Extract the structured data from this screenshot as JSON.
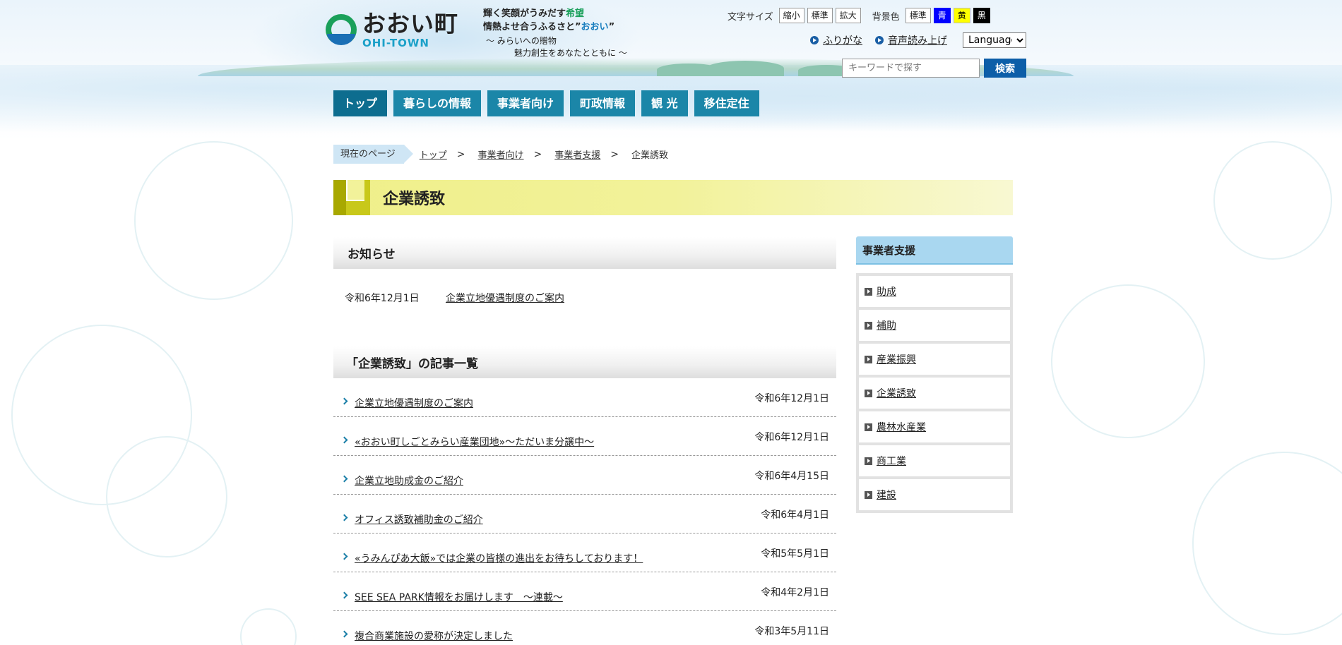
{
  "header": {
    "logo_jp": "おおい町",
    "logo_en": "OHI-TOWN",
    "tagline": {
      "line1_a": "輝く笑顔がうみだす",
      "line1_hl": "希望",
      "line2_a": "情熱よせ合うふるさと”",
      "line2_hl": "おおい",
      "line2_b": "”",
      "line3": "～ みらいへの贈物",
      "line4": "魅力創生をあなたとともに ～"
    },
    "font_size_label": "文字サイズ",
    "font_size_options": [
      "縮小",
      "標準",
      "拡大"
    ],
    "bg_color_label": "背景色",
    "bg_color_options": [
      "標準",
      "青",
      "黄",
      "黒"
    ],
    "furigana_link": "ふりがな",
    "speech_link": "音声読み上げ",
    "language_selected": "Language",
    "search": {
      "placeholder": "キーワードで探す",
      "button": "検索"
    }
  },
  "nav": {
    "items": [
      "トップ",
      "暮らしの情報",
      "事業者向け",
      "町政情報",
      "観 光",
      "移住定住"
    ],
    "active_index": 0
  },
  "breadcrumb": {
    "current_label": "現在のページ",
    "items": [
      "トップ",
      "事業者向け",
      "事業者支援"
    ],
    "current": "企業誘致",
    "separator": ">"
  },
  "page_title": "企業誘致",
  "notice": {
    "heading": "お知らせ",
    "date": "令和6年12月1日",
    "link": "企業立地優遇制度のご案内"
  },
  "article_list": {
    "heading": "「企業誘致」の記事一覧",
    "items": [
      {
        "title": "企業立地優遇制度のご案内",
        "date": "令和6年12月1日"
      },
      {
        "title": "«おおい町しごとみらい産業団地»～ただいま分譲中～",
        "date": "令和6年12月1日"
      },
      {
        "title": "企業立地助成金のご紹介",
        "date": "令和6年4月15日"
      },
      {
        "title": "オフィス誘致補助金のご紹介",
        "date": "令和6年4月1日"
      },
      {
        "title": "«うみんぴあ大飯»では企業の皆様の進出をお待ちしております！",
        "date": "令和5年5月1日"
      },
      {
        "title": "SEE SEA PARK情報をお届けします　～連載～",
        "date": "令和4年2月1日"
      },
      {
        "title": "複合商業施設の愛称が決定しました",
        "date": "令和3年5月11日"
      }
    ]
  },
  "sidebar": {
    "heading": "事業者支援",
    "items": [
      "助成",
      "補助",
      "産業振興",
      "企業誘致",
      "農林水産業",
      "商工業",
      "建設"
    ]
  },
  "colors": {
    "nav_bg": "#1b86a8",
    "search_button": "#0c5ea8",
    "title_bar": "#efef8a",
    "sidebar_heading": "#a9d7f0"
  }
}
